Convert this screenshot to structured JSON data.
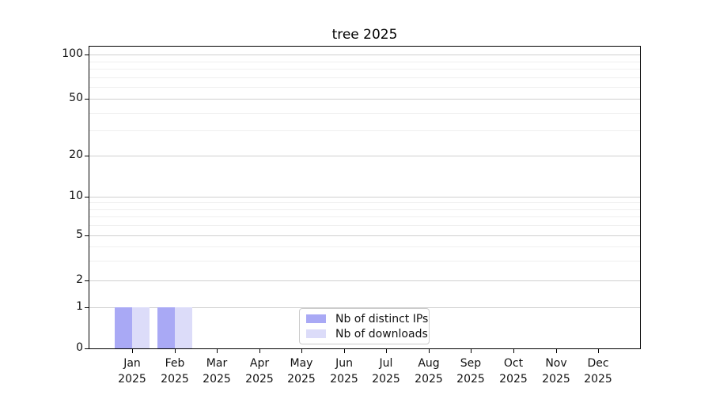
{
  "chart_data": {
    "type": "bar",
    "title": "tree 2025",
    "y_scale": "log-like (0,1,2,5,10,20,50,100)",
    "grid": true,
    "legend_position": "bottom-center",
    "categories": [
      {
        "month": "Jan",
        "year": "2025"
      },
      {
        "month": "Feb",
        "year": "2025"
      },
      {
        "month": "Mar",
        "year": "2025"
      },
      {
        "month": "Apr",
        "year": "2025"
      },
      {
        "month": "May",
        "year": "2025"
      },
      {
        "month": "Jun",
        "year": "2025"
      },
      {
        "month": "Jul",
        "year": "2025"
      },
      {
        "month": "Aug",
        "year": "2025"
      },
      {
        "month": "Sep",
        "year": "2025"
      },
      {
        "month": "Oct",
        "year": "2025"
      },
      {
        "month": "Nov",
        "year": "2025"
      },
      {
        "month": "Dec",
        "year": "2025"
      }
    ],
    "series": [
      {
        "name": "Nb of distinct IPs",
        "color": "#a9a9f5",
        "values": [
          1,
          1,
          0,
          0,
          0,
          0,
          0,
          0,
          0,
          0,
          0,
          0
        ]
      },
      {
        "name": "Nb of downloads",
        "color": "#dcdcf9",
        "values": [
          1,
          1,
          0,
          0,
          0,
          0,
          0,
          0,
          0,
          0,
          0,
          0
        ]
      }
    ],
    "y_axis": {
      "tick_values": [
        100,
        50,
        20,
        10,
        5,
        2,
        1,
        0
      ],
      "tick_labels": [
        "100",
        "50",
        "20",
        "10",
        "5",
        "2",
        "1",
        "0"
      ],
      "minor_gridline_values": [
        90,
        80,
        70,
        60,
        40,
        30,
        9,
        8,
        7,
        6,
        4,
        3
      ],
      "ylim": [
        0,
        112
      ]
    }
  },
  "colors": {
    "background": "#ffffff",
    "axis": "#000000",
    "text": "#111111",
    "grid_minor": "#efefef",
    "grid_major": "#cfcfcf",
    "legend_border": "#cccccc",
    "bar_distinct_ips": "#a9a9f5",
    "bar_downloads": "#dcdcf9"
  }
}
